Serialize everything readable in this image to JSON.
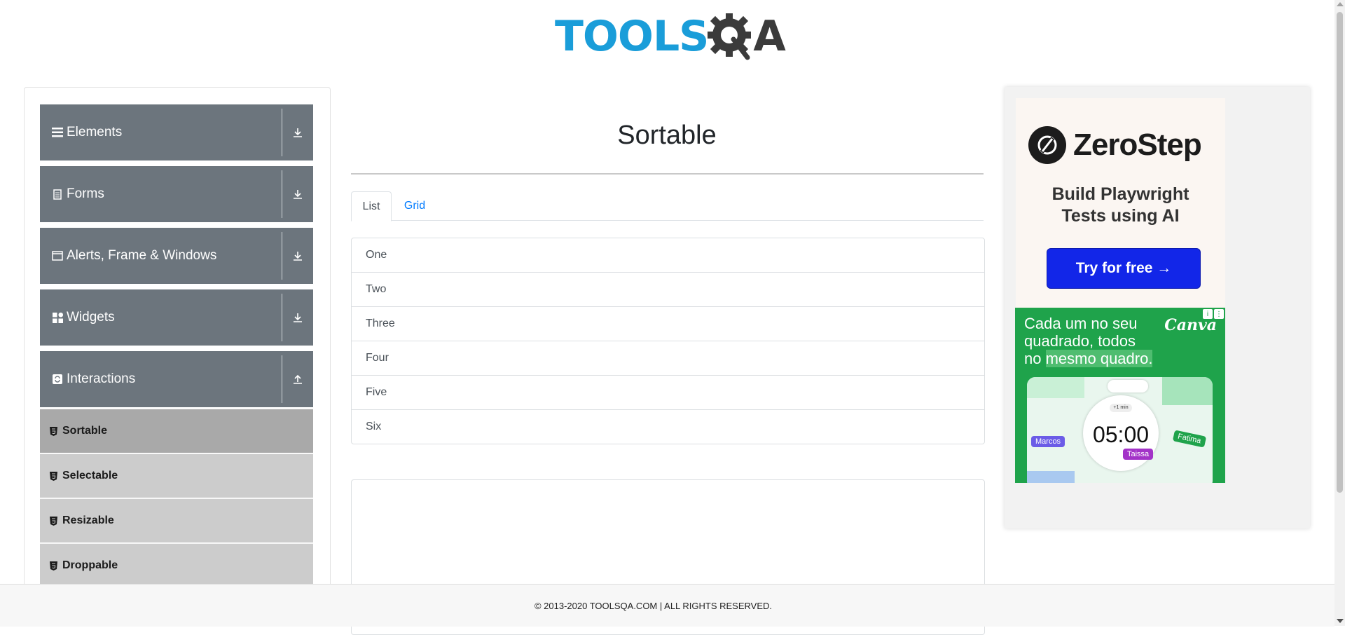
{
  "header": {
    "logo_text_1": "TOOLS",
    "logo_text_2": "A",
    "logo_icon": "gear-q-icon"
  },
  "sidebar": {
    "groups": [
      {
        "label": "Elements",
        "icon": "hamburger-icon",
        "arrow": "download-icon"
      },
      {
        "label": "Forms",
        "icon": "document-icon",
        "arrow": "download-icon"
      },
      {
        "label": "Alerts, Frame & Windows",
        "icon": "window-icon",
        "arrow": "download-icon"
      },
      {
        "label": "Widgets",
        "icon": "widgets-icon",
        "arrow": "download-icon"
      },
      {
        "label": "Interactions",
        "icon": "refresh-icon",
        "arrow": "upload-icon"
      }
    ],
    "items": [
      {
        "label": "Sortable",
        "active": true
      },
      {
        "label": "Selectable",
        "active": false
      },
      {
        "label": "Resizable",
        "active": false
      },
      {
        "label": "Droppable",
        "active": false
      }
    ]
  },
  "main": {
    "title": "Sortable",
    "tabs": [
      {
        "label": "List",
        "active": true
      },
      {
        "label": "Grid",
        "active": false
      }
    ],
    "list": [
      "One",
      "Two",
      "Three",
      "Four",
      "Five",
      "Six"
    ]
  },
  "ads": {
    "zerostep": {
      "name": "ZeroStep",
      "tagline_1": "Build Playwright",
      "tagline_2": "Tests using AI",
      "button": "Try for free →"
    },
    "canva": {
      "line_1": "Cada um no seu",
      "line_2": "quadrado, todos",
      "line_3_plain": "no ",
      "line_3_highlight": "mesmo quadro.",
      "brand": "Canva",
      "timer": "05:00",
      "timer_label": "+1 min",
      "name_1": "Marcos",
      "name_2": "Fatima",
      "name_3": "Taissa"
    }
  },
  "footer": {
    "text": "© 2013-2020 TOOLSQA.COM | ALL RIGHTS RESERVED."
  },
  "colors": {
    "sidebar_group": "#6c757d",
    "sub_active": "#a9a9a9",
    "sub_inactive": "#cccccc",
    "link": "#007bff",
    "brand_blue": "#1a9dd9"
  }
}
